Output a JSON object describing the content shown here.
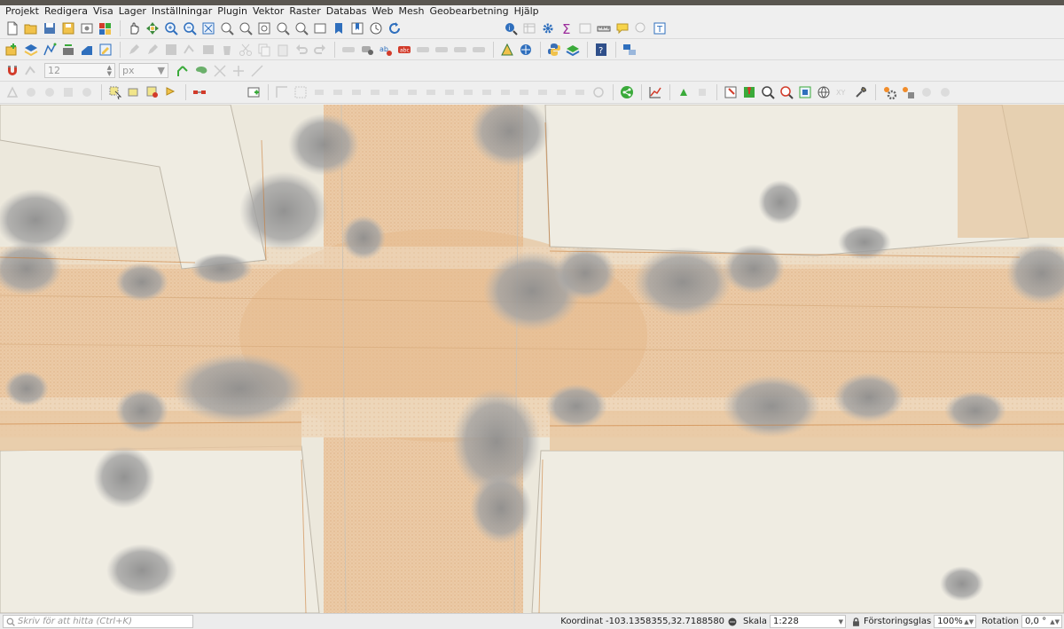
{
  "menu": [
    "Projekt",
    "Redigera",
    "Visa",
    "Lager",
    "Inställningar",
    "Plugin",
    "Vektor",
    "Raster",
    "Databas",
    "Web",
    "Mesh",
    "Geobearbetning",
    "Hjälp"
  ],
  "snapping": {
    "tolerance_value": "12",
    "unit": "px"
  },
  "statusbar": {
    "locator_placeholder": "Skriv för att hitta (Ctrl+K)",
    "coordinate_label": "Koordinat",
    "coordinate_value": "-103.1358355,32.7188580",
    "scale_label": "Skala",
    "scale_value": "1:228",
    "magnifier_label": "Förstoringsglas",
    "magnifier_value": "100%",
    "rotation_label": "Rotation",
    "rotation_value": "0,0 °"
  },
  "colors": {
    "map_background": "#ece8dc",
    "road_surface": "#e9c9a4",
    "vegetation": "#9a9a9a",
    "building_block": "#efece2",
    "accent_blue": "#2f6fbd",
    "accent_green": "#3aaa3a",
    "accent_red": "#d23b2a"
  },
  "icons": {
    "toolbar1": [
      "new-project-icon",
      "open-project-icon",
      "save-project-icon",
      "save-as-icon",
      "print-layout-icon",
      "style-manager-icon",
      "pan-icon",
      "pan-to-selection-icon",
      "zoom-in-icon",
      "zoom-out-icon",
      "zoom-full-icon",
      "zoom-to-selection-icon",
      "zoom-to-layer-icon",
      "zoom-native-icon",
      "zoom-last-icon",
      "zoom-next-icon",
      "new-map-view-icon",
      "bookmark-icon",
      "show-bookmarks-icon",
      "temporal-controller-icon",
      "refresh-icon",
      "identify-icon",
      "attribute-table-icon",
      "settings-gear-icon",
      "statistics-sum-icon",
      "open-table-icon",
      "measure-icon",
      "map-tips-icon",
      "vertex-tool-icon",
      "text-annotation-icon"
    ],
    "toolbar2": [
      "data-source-manager-icon",
      "new-layer-icon",
      "digitize-icon",
      "virtual-layer-icon",
      "temp-layer-icon",
      "current-edits-icon",
      "toggle-editing-icon",
      "save-edits-icon",
      "add-feature-icon",
      "vertex-editor-icon",
      "delete-icon",
      "cut-icon",
      "copy-icon",
      "paste-icon",
      "undo-icon",
      "redo-icon",
      "label-icon",
      "label-pin-icon",
      "label-highlight-icon",
      "label-layer-icon",
      "label-move-icon",
      "label-rotate-icon",
      "label-change-icon",
      "label-show-icon",
      "gps-triangle-icon",
      "georeferencer-icon",
      "python-icon",
      "plugin-manager-icon",
      "help-icon",
      "processing-icon"
    ],
    "toolbar3": [
      "snapping-magnet-icon",
      "snap-layers-icon",
      "tracing-icon",
      "topology-icon",
      "snap-intersection-icon",
      "self-snap-icon"
    ],
    "toolbar4": [
      "add-point-icon",
      "add-line-icon",
      "add-polygon-icon",
      "add-ring-icon",
      "select-feature-icon",
      "select-by-value-icon",
      "deselect-icon",
      "measure-line-icon",
      "open-field-calc-icon",
      "add-feature-icon",
      "vertex-tool-icon",
      "advanced-digitizing-icon",
      "reshape-icon",
      "split-icon",
      "merge-icon",
      "rotate-icon",
      "offset-curve-icon",
      "simplify-icon",
      "fill-ring-icon",
      "delete-part-icon",
      "delete-ring-icon",
      "split-parts-icon",
      "move-feature-icon",
      "share-icon",
      "elevation-profile-icon",
      "label-tool-icon",
      "add-pin-icon",
      "identify-2-icon",
      "zoom-rect-icon",
      "zoom-layer-icon",
      "world-icon",
      "xy-tool-icon",
      "wrench-icon",
      "gear-tool-icon",
      "spanner-plus-icon",
      "measure-area-icon",
      "measure-angle-icon"
    ]
  }
}
